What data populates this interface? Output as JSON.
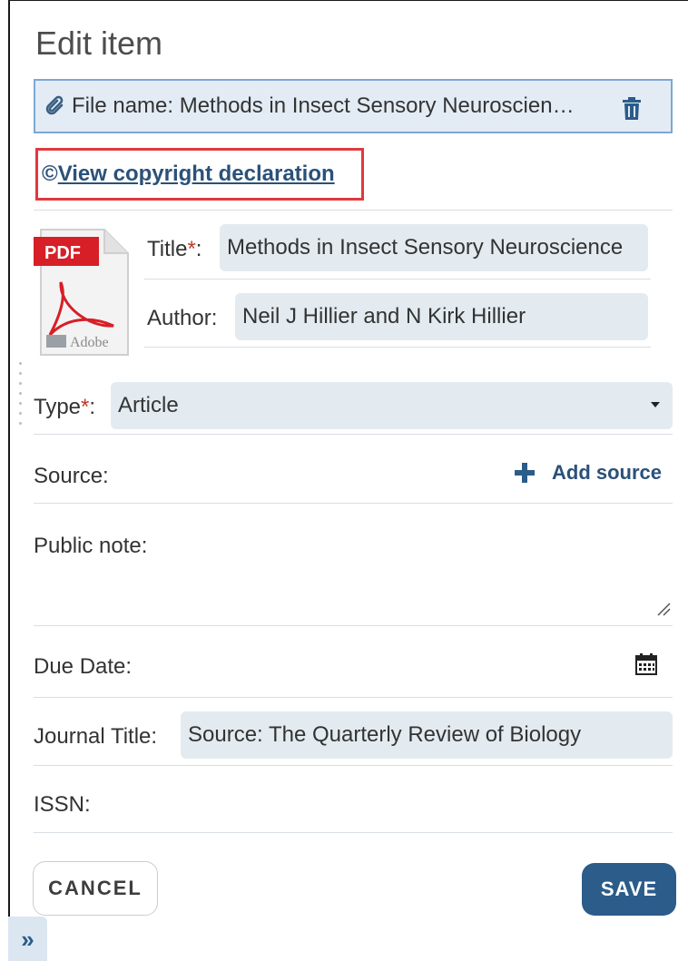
{
  "panel": {
    "title": "Edit item"
  },
  "file": {
    "label": "File name: Methods in Insect Sensory Neuroscien…"
  },
  "copyright": {
    "symbol": "©",
    "link_text": "View copyright declaration"
  },
  "thumbnail": {
    "badge": "PDF",
    "caption": "Adobe"
  },
  "fields": {
    "title": {
      "label": "Title",
      "required_mark": "*",
      "colon": ":",
      "value": "Methods in Insect Sensory Neuroscience"
    },
    "author": {
      "label": "Author:",
      "value": "Neil J Hillier and N Kirk Hillier"
    },
    "type": {
      "label": "Type",
      "required_mark": "*",
      "colon": ":",
      "value": "Article"
    },
    "source": {
      "label": "Source:",
      "add_label": "Add source"
    },
    "public_note": {
      "label": "Public note:"
    },
    "due_date": {
      "label": "Due Date:"
    },
    "journal_title": {
      "label": "Journal Title:",
      "value": "Source: The Quarterly Review of Biology"
    },
    "issn": {
      "label": "ISSN:"
    }
  },
  "buttons": {
    "cancel": "CANCEL",
    "save": "SAVE",
    "expand": "»"
  },
  "icons": [
    "paperclip-icon",
    "trash-icon",
    "pdf-icon",
    "plus-icon",
    "calendar-icon",
    "chevron-down-icon",
    "resize-handle-icon",
    "double-chevron-right-icon"
  ],
  "colors": {
    "accent": "#2b5c8a",
    "link": "#2b5179",
    "field_bg": "#e3ebf0",
    "highlight_border": "#e0383e",
    "required": "#c0392b"
  }
}
